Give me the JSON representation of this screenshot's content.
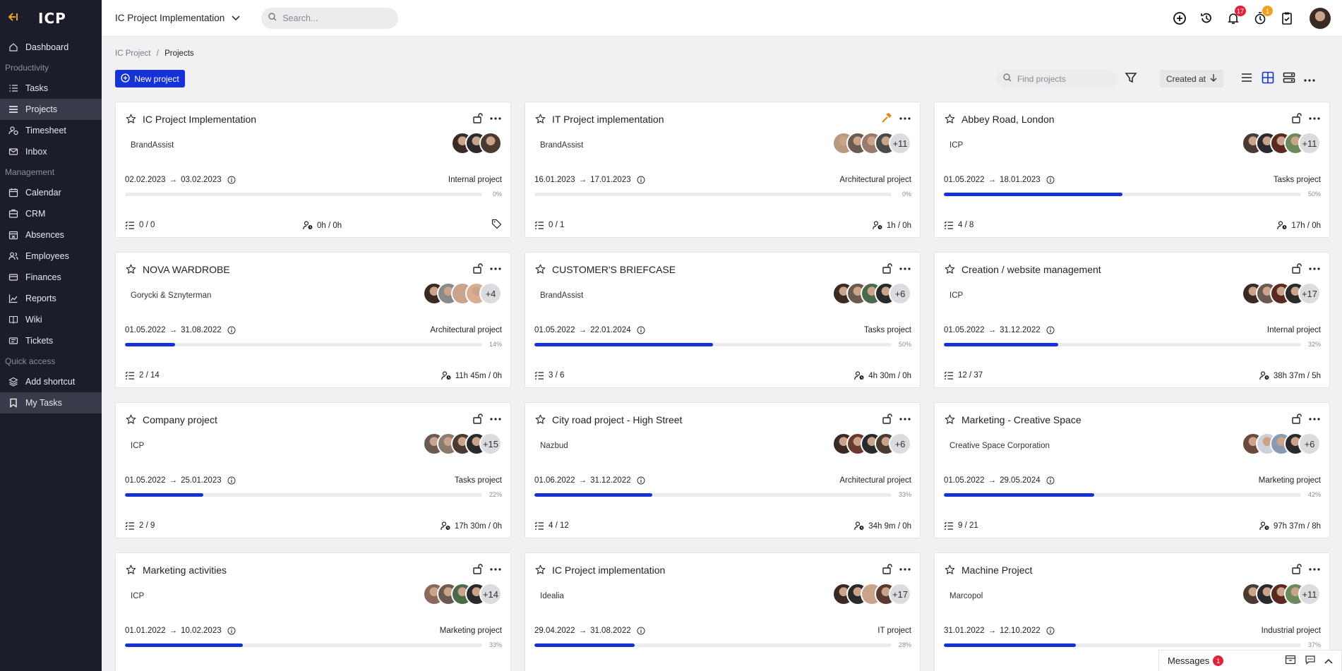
{
  "app": {
    "logo": "ICP",
    "collapse_icon": "arrow-left-icon"
  },
  "sidebar": {
    "items": [
      {
        "label": "Dashboard",
        "icon": "home-icon",
        "type": "item"
      },
      {
        "label": "Productivity",
        "type": "section"
      },
      {
        "label": "Tasks",
        "icon": "tasks-icon",
        "type": "item"
      },
      {
        "label": "Projects",
        "icon": "list-icon",
        "type": "item",
        "active": true
      },
      {
        "label": "Timesheet",
        "icon": "user-clock-icon",
        "type": "item"
      },
      {
        "label": "Inbox",
        "icon": "mail-icon",
        "type": "item"
      },
      {
        "label": "Management",
        "type": "section"
      },
      {
        "label": "Calendar",
        "icon": "calendar-icon",
        "type": "item"
      },
      {
        "label": "CRM",
        "icon": "crm-icon",
        "type": "item"
      },
      {
        "label": "Absences",
        "icon": "absences-icon",
        "type": "item"
      },
      {
        "label": "Employees",
        "icon": "employees-icon",
        "type": "item"
      },
      {
        "label": "Finances",
        "icon": "finances-icon",
        "type": "item"
      },
      {
        "label": "Reports",
        "icon": "reports-icon",
        "type": "item"
      },
      {
        "label": "Wiki",
        "icon": "wiki-icon",
        "type": "item"
      },
      {
        "label": "Tickets",
        "icon": "tickets-icon",
        "type": "item"
      },
      {
        "label": "Quick access",
        "type": "section"
      },
      {
        "label": "Add shortcut",
        "icon": "layers-icon",
        "type": "item"
      },
      {
        "label": "My Tasks",
        "icon": "bookmark-icon",
        "type": "item",
        "active": true
      }
    ]
  },
  "topbar": {
    "project_select": "IC Project Implementation",
    "search_placeholder": "Search...",
    "notifications_count": "17",
    "timer_count": "1"
  },
  "breadcrumb": {
    "root": "IC Project",
    "separator": "/",
    "current": "Projects"
  },
  "toolbar": {
    "new_project": "New project",
    "find_placeholder": "Find projects",
    "sort_label": "Created at"
  },
  "colors": {
    "accent": "#1432d6",
    "sidebar_bg": "#1c1d2b",
    "badge_red": "#e0223a",
    "badge_orange": "#f0a020"
  },
  "projects": [
    {
      "title": "IC Project Implementation",
      "client": "BrandAssist",
      "start": "02.02.2023",
      "end": "03.02.2023",
      "type": "Internal project",
      "progress": 0,
      "progress_label": "0%",
      "tasks": "0 / 0",
      "time": "0h / 0h",
      "extra_count": "",
      "avatar_colors": [
        "#3a2a22",
        "#2b2b2b",
        "#4a3a30"
      ],
      "status_icon": "unlock-icon",
      "show_tag": true
    },
    {
      "title": "IT Project implementation",
      "client": "BrandAssist",
      "start": "16.01.2023",
      "end": "17.01.2023",
      "type": "Architectural project",
      "progress": 0,
      "progress_label": "0%",
      "tasks": "0 / 1",
      "time": "1h / 0h",
      "extra_count": "+11",
      "avatar_colors": [
        "#b89a80",
        "#6a5a50",
        "#9a7a6a",
        "#4a4a4a"
      ],
      "status_icon": "hammer-icon",
      "show_tag": false
    },
    {
      "title": "Abbey Road, London",
      "client": "ICP",
      "start": "01.05.2022",
      "end": "18.01.2023",
      "type": "Tasks project",
      "progress": 50,
      "progress_label": "50%",
      "tasks": "4 / 8",
      "time": "17h / 0h",
      "extra_count": "+11",
      "avatar_colors": [
        "#4a3a30",
        "#2a2a2a",
        "#5a2a20",
        "#6a8a5a"
      ],
      "status_icon": "unlock-icon",
      "show_tag": false
    },
    {
      "title": "NOVA WARDROBE",
      "client": "Gorycki & Sznyterman",
      "start": "01.05.2022",
      "end": "31.08.2022",
      "type": "Architectural project",
      "progress": 14,
      "progress_label": "14%",
      "tasks": "2 / 14",
      "time": "11h 45m / 0h",
      "extra_count": "+4",
      "avatar_colors": [
        "#3a2a22",
        "#8a8a8a",
        "#c9a48a",
        "#d8b090"
      ],
      "status_icon": "unlock-icon",
      "show_tag": false
    },
    {
      "title": "CUSTOMER'S BRIEFCASE",
      "client": "BrandAssist",
      "start": "01.05.2022",
      "end": "22.01.2024",
      "type": "Tasks project",
      "progress": 50,
      "progress_label": "50%",
      "tasks": "3 / 6",
      "time": "4h 30m / 0h",
      "extra_count": "+6",
      "avatar_colors": [
        "#3a2a22",
        "#6a5a50",
        "#4a6a4a",
        "#2a2a2a"
      ],
      "status_icon": "unlock-icon",
      "show_tag": false
    },
    {
      "title": "Creation / website management",
      "client": "ICP",
      "start": "01.05.2022",
      "end": "31.12.2022",
      "type": "Internal project",
      "progress": 32,
      "progress_label": "32%",
      "tasks": "12 / 37",
      "time": "38h 37m / 5h",
      "extra_count": "+17",
      "avatar_colors": [
        "#3a2a22",
        "#6a5a50",
        "#5a2a20",
        "#2a2a2a"
      ],
      "status_icon": "unlock-icon",
      "show_tag": false
    },
    {
      "title": "Company project",
      "client": "ICP",
      "start": "01.05.2022",
      "end": "25.01.2023",
      "type": "Tasks project",
      "progress": 22,
      "progress_label": "22%",
      "tasks": "2 / 9",
      "time": "17h 30m / 0h",
      "extra_count": "+15",
      "avatar_colors": [
        "#6a5a50",
        "#8a7a70",
        "#4a3a30",
        "#2a2a2a"
      ],
      "status_icon": "unlock-icon",
      "show_tag": false
    },
    {
      "title": "City road project - High Street",
      "client": "Nazbud",
      "start": "01.06.2022",
      "end": "31.12.2022",
      "type": "Architectural project",
      "progress": 33,
      "progress_label": "33%",
      "tasks": "4 / 12",
      "time": "34h 9m / 0h",
      "extra_count": "+6",
      "avatar_colors": [
        "#3a2a22",
        "#6a3a30",
        "#2a2a2a",
        "#4a3a30"
      ],
      "status_icon": "unlock-icon",
      "show_tag": false
    },
    {
      "title": "Marketing - Creative Space",
      "client": "Creative Space Corporation",
      "start": "01.05.2022",
      "end": "29.05.2024",
      "type": "Marketing project",
      "progress": 42,
      "progress_label": "42%",
      "tasks": "9 / 21",
      "time": "97h 37m / 8h",
      "extra_count": "+6",
      "avatar_colors": [
        "#6a4a3a",
        "#d0d0d8",
        "#8a9ab0",
        "#2a2a2a"
      ],
      "status_icon": "unlock-icon",
      "show_tag": false
    },
    {
      "title": "Marketing activities",
      "client": "ICP",
      "start": "01.01.2022",
      "end": "10.02.2023",
      "type": "Marketing project",
      "progress": 33,
      "progress_label": "33%",
      "tasks": "",
      "time": "",
      "extra_count": "+14",
      "avatar_colors": [
        "#8a6a5a",
        "#6a5a50",
        "#4a6a4a",
        "#2a2a2a"
      ],
      "status_icon": "unlock-icon",
      "show_tag": false
    },
    {
      "title": "IC Project implementation",
      "client": "Idealia",
      "start": "29.04.2022",
      "end": "31.08.2022",
      "type": "IT project",
      "progress": 28,
      "progress_label": "28%",
      "tasks": "",
      "time": "",
      "extra_count": "+17",
      "avatar_colors": [
        "#3a2a22",
        "#2a2a2a",
        "#c9a48a",
        "#5a3a30"
      ],
      "status_icon": "unlock-icon",
      "show_tag": false
    },
    {
      "title": "Machine Project",
      "client": "Marcopol",
      "start": "31.01.2022",
      "end": "12.10.2022",
      "type": "Industrial project",
      "progress": 37,
      "progress_label": "37%",
      "tasks": "",
      "time": "",
      "extra_count": "+11",
      "avatar_colors": [
        "#4a3a30",
        "#2a2a2a",
        "#5a2a20",
        "#6a8a5a"
      ],
      "status_icon": "unlock-icon",
      "show_tag": false
    }
  ],
  "messages": {
    "label": "Messages",
    "count": "1"
  }
}
